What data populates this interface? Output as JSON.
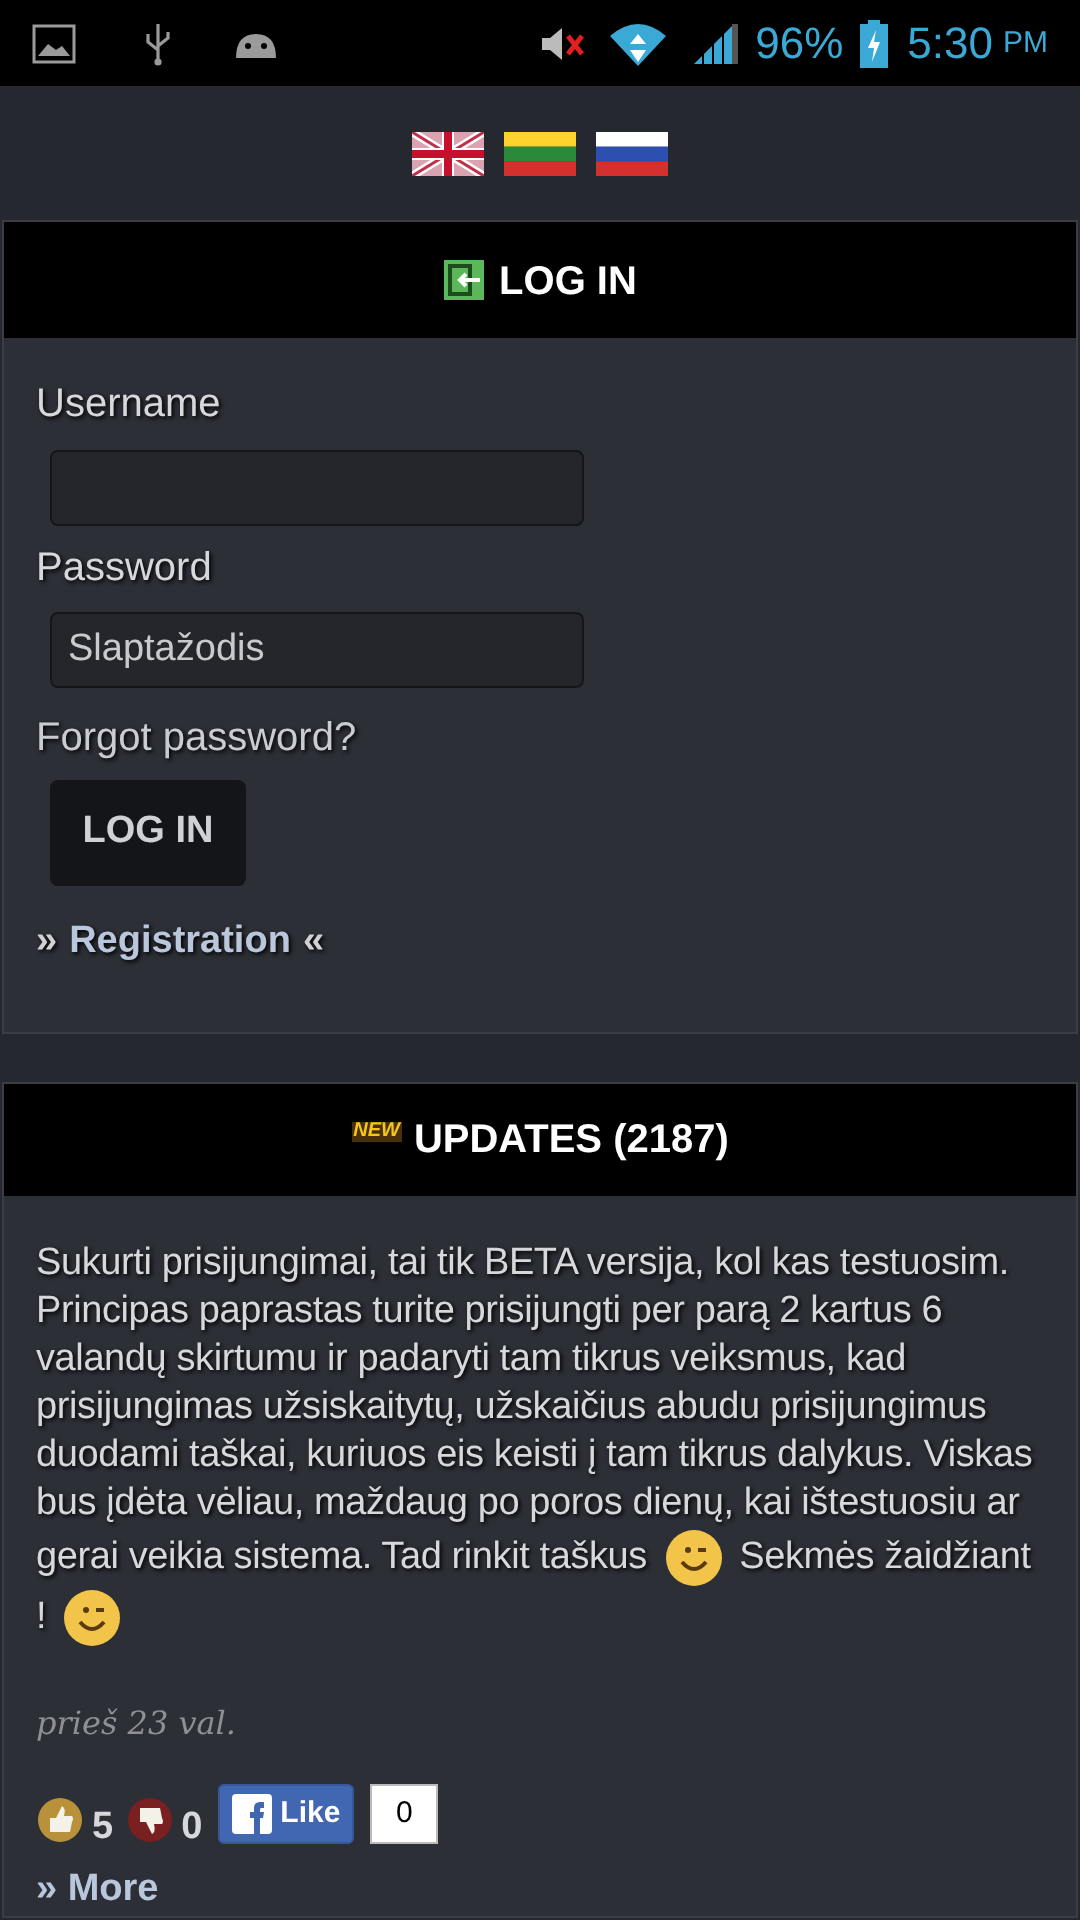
{
  "status_bar": {
    "battery": "96%",
    "time": "5:30",
    "meridiem": "PM"
  },
  "languages": [
    {
      "kind": "uk",
      "selected": false
    },
    {
      "kind": "lt",
      "selected": false
    },
    {
      "kind": "ru",
      "selected": false
    }
  ],
  "login": {
    "title": "LOG IN",
    "username_label": "Username",
    "password_label": "Password",
    "password_placeholder": "Slaptažodis",
    "forgot": "Forgot password?",
    "button": "LOG IN",
    "registration_left": "»",
    "registration": "Registration",
    "registration_right": "«"
  },
  "updates": {
    "badge": "NEW",
    "title": "UPDATES (2187)",
    "parts": [
      {
        "kind": "text",
        "text": "Sukurti prisijungimai, tai tik BETA versija, kol kas testuosim. Principas paprastas turite prisijungti per parą 2 kartus 6 valandų skirtumu ir padaryti tam tikrus veiksmus, kad prisijungimas užsiskaitytų, užskaičius abudu prisijungimus duodami taškai, kuriuos eis keisti į tam tikrus dalykus. Viskas bus įdėta vėliau, maždaug po poros dienų, kai ištestuosiu ar gerai veikia sistema. Tad rinkit taškus"
      },
      {
        "kind": "smiley"
      },
      {
        "kind": "text",
        "text": "Sekmės žaidžiant !"
      },
      {
        "kind": "smiley"
      }
    ],
    "time": "prieš 23 val.",
    "likes": "5",
    "dislikes": "0",
    "fb_like": "Like",
    "fb_count": "0",
    "more": "» More"
  }
}
